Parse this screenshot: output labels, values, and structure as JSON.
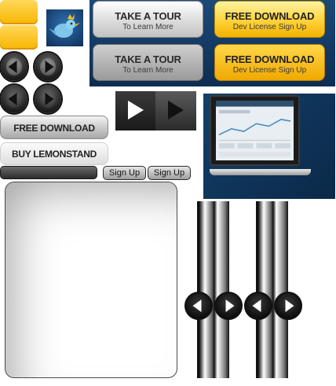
{
  "banner": {
    "tour_top": {
      "line1": "TAKE A TOUR",
      "line2": "To Learn More"
    },
    "download_top": {
      "line1": "FREE DOWNLOAD",
      "line2": "Dev License Sign Up"
    },
    "tour_bottom": {
      "line1": "TAKE A TOUR",
      "line2": "To Learn More"
    },
    "download_bottom": {
      "line1": "FREE DOWNLOAD",
      "line2": "Dev License Sign Up"
    }
  },
  "buttons": {
    "free_download": "FREE DOWNLOAD",
    "buy_lemonstand": "BUY LEMONSTAND"
  },
  "signup": {
    "button1": "Sign Up",
    "button2": "Sign Up"
  },
  "icons": {
    "arrow_left": "arrow-left-icon",
    "arrow_right": "arrow-right-icon",
    "play": "play-icon"
  },
  "colors": {
    "accent_yellow": "#ffd23a",
    "banner_blue": "#1c4a78",
    "dark": "#1b1b1b"
  }
}
